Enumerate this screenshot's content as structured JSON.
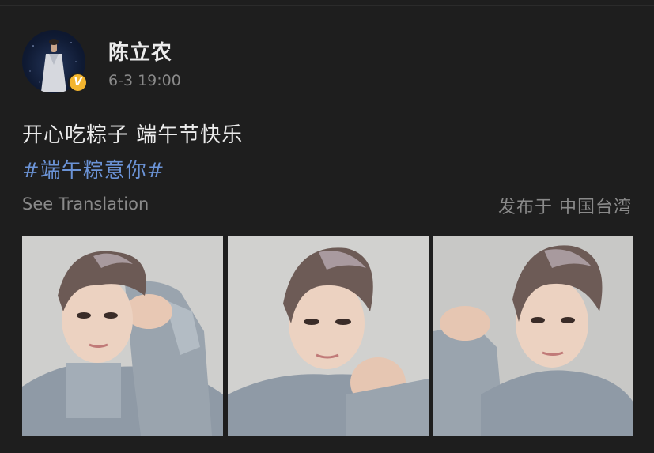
{
  "post": {
    "username": "陈立农",
    "verified_badge": "V",
    "timestamp": "6-3 19:00",
    "text": "开心吃粽子 端午节快乐",
    "hashtag": "#端午粽意你#",
    "see_translation": "See Translation",
    "location": "发布于 中国台湾",
    "avatar_icon": "avatar-photo",
    "photos": [
      {
        "name": "photo-1",
        "alt": "selfie with raised fist"
      },
      {
        "name": "photo-2",
        "alt": "selfie with fist in front"
      },
      {
        "name": "photo-3",
        "alt": "selfie with raised fist"
      }
    ]
  },
  "colors": {
    "background": "#1e1e1e",
    "primary_text": "#ececec",
    "secondary_text": "#8a8a8a",
    "hashtag": "#6b93d6",
    "verified_badge": "#f3b52f"
  }
}
